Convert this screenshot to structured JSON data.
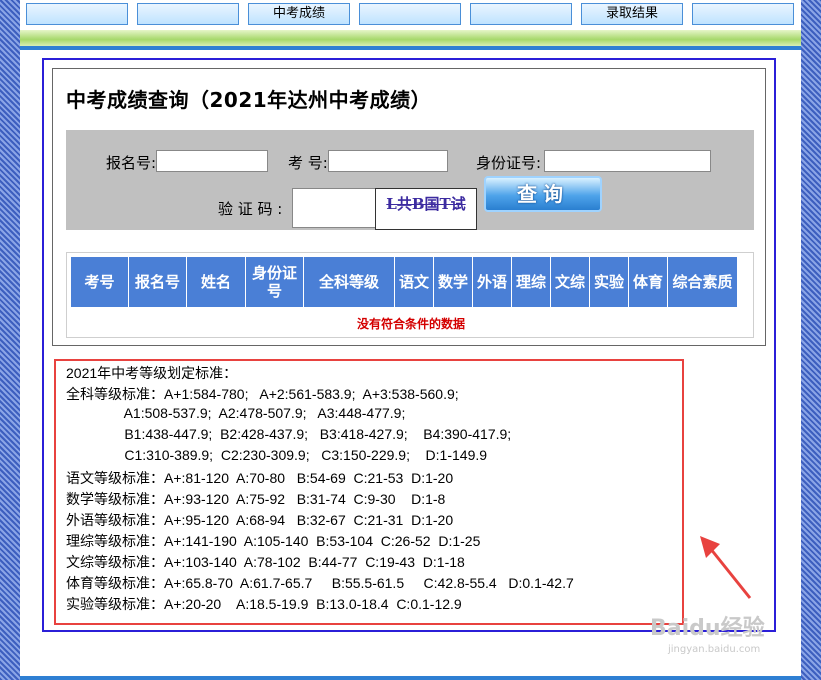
{
  "nav": {
    "items": [
      "",
      "",
      "中考成绩",
      "",
      "",
      "录取结果",
      ""
    ]
  },
  "page": {
    "title": "中考成绩查询（2021年达州中考成绩）"
  },
  "form": {
    "reg_label": "报名号:",
    "exam_label": "考 号:",
    "id_label": "身份证号:",
    "captcha_label": "验 证 码 :",
    "reg_value": "",
    "exam_value": "",
    "id_value": "",
    "captcha_value": "",
    "captcha_text": "L共B国T试",
    "query_button": "查询"
  },
  "table": {
    "headers": [
      "考号",
      "报名号",
      "姓名",
      "身份证号",
      "全科等级",
      "语文",
      "数学",
      "外语",
      "理综",
      "文综",
      "实验",
      "体育",
      "综合素质"
    ],
    "empty_message": "没有符合条件的数据"
  },
  "standards": {
    "lines": [
      "2021年中考等级划定标准：",
      "全科等级标准：A+1:584-780;   A+2:561-583.9;  A+3:538-560.9;",
      "               A1:508-537.9;  A2:478-507.9;   A3:448-477.9;",
      "               B1:438-447.9;  B2:428-437.9;   B3:418-427.9;    B4:390-417.9;",
      "               C1:310-389.9;  C2:230-309.9;   C3:150-229.9;    D:1-149.9",
      "语文等级标准：A+:81-120  A:70-80   B:54-69  C:21-53  D:1-20",
      "数学等级标准：A+:93-120  A:75-92   B:31-74  C:9-30    D:1-8",
      "外语等级标准：A+:95-120  A:68-94   B:32-67  C:21-31  D:1-20",
      "理综等级标准：A+:141-190  A:105-140  B:53-104  C:26-52  D:1-25",
      "文综等级标准：A+:103-140  A:78-102  B:44-77  C:19-43  D:1-18",
      "体育等级标准：A+:65.8-70  A:61.7-65.7     B:55.5-61.5     C:42.8-55.4   D:0.1-42.7",
      "实验等级标准：A+:20-20    A:18.5-19.9  B:13.0-18.4  C:0.1-12.9"
    ]
  },
  "watermark": {
    "brand": "Baidu经验",
    "url": "jingyan.baidu.com"
  },
  "colors": {
    "header_bg": "#4a7fd6",
    "highlight_border": "#e8423f",
    "frame_border": "#2b1fd8",
    "empty_text": "#d40000"
  }
}
